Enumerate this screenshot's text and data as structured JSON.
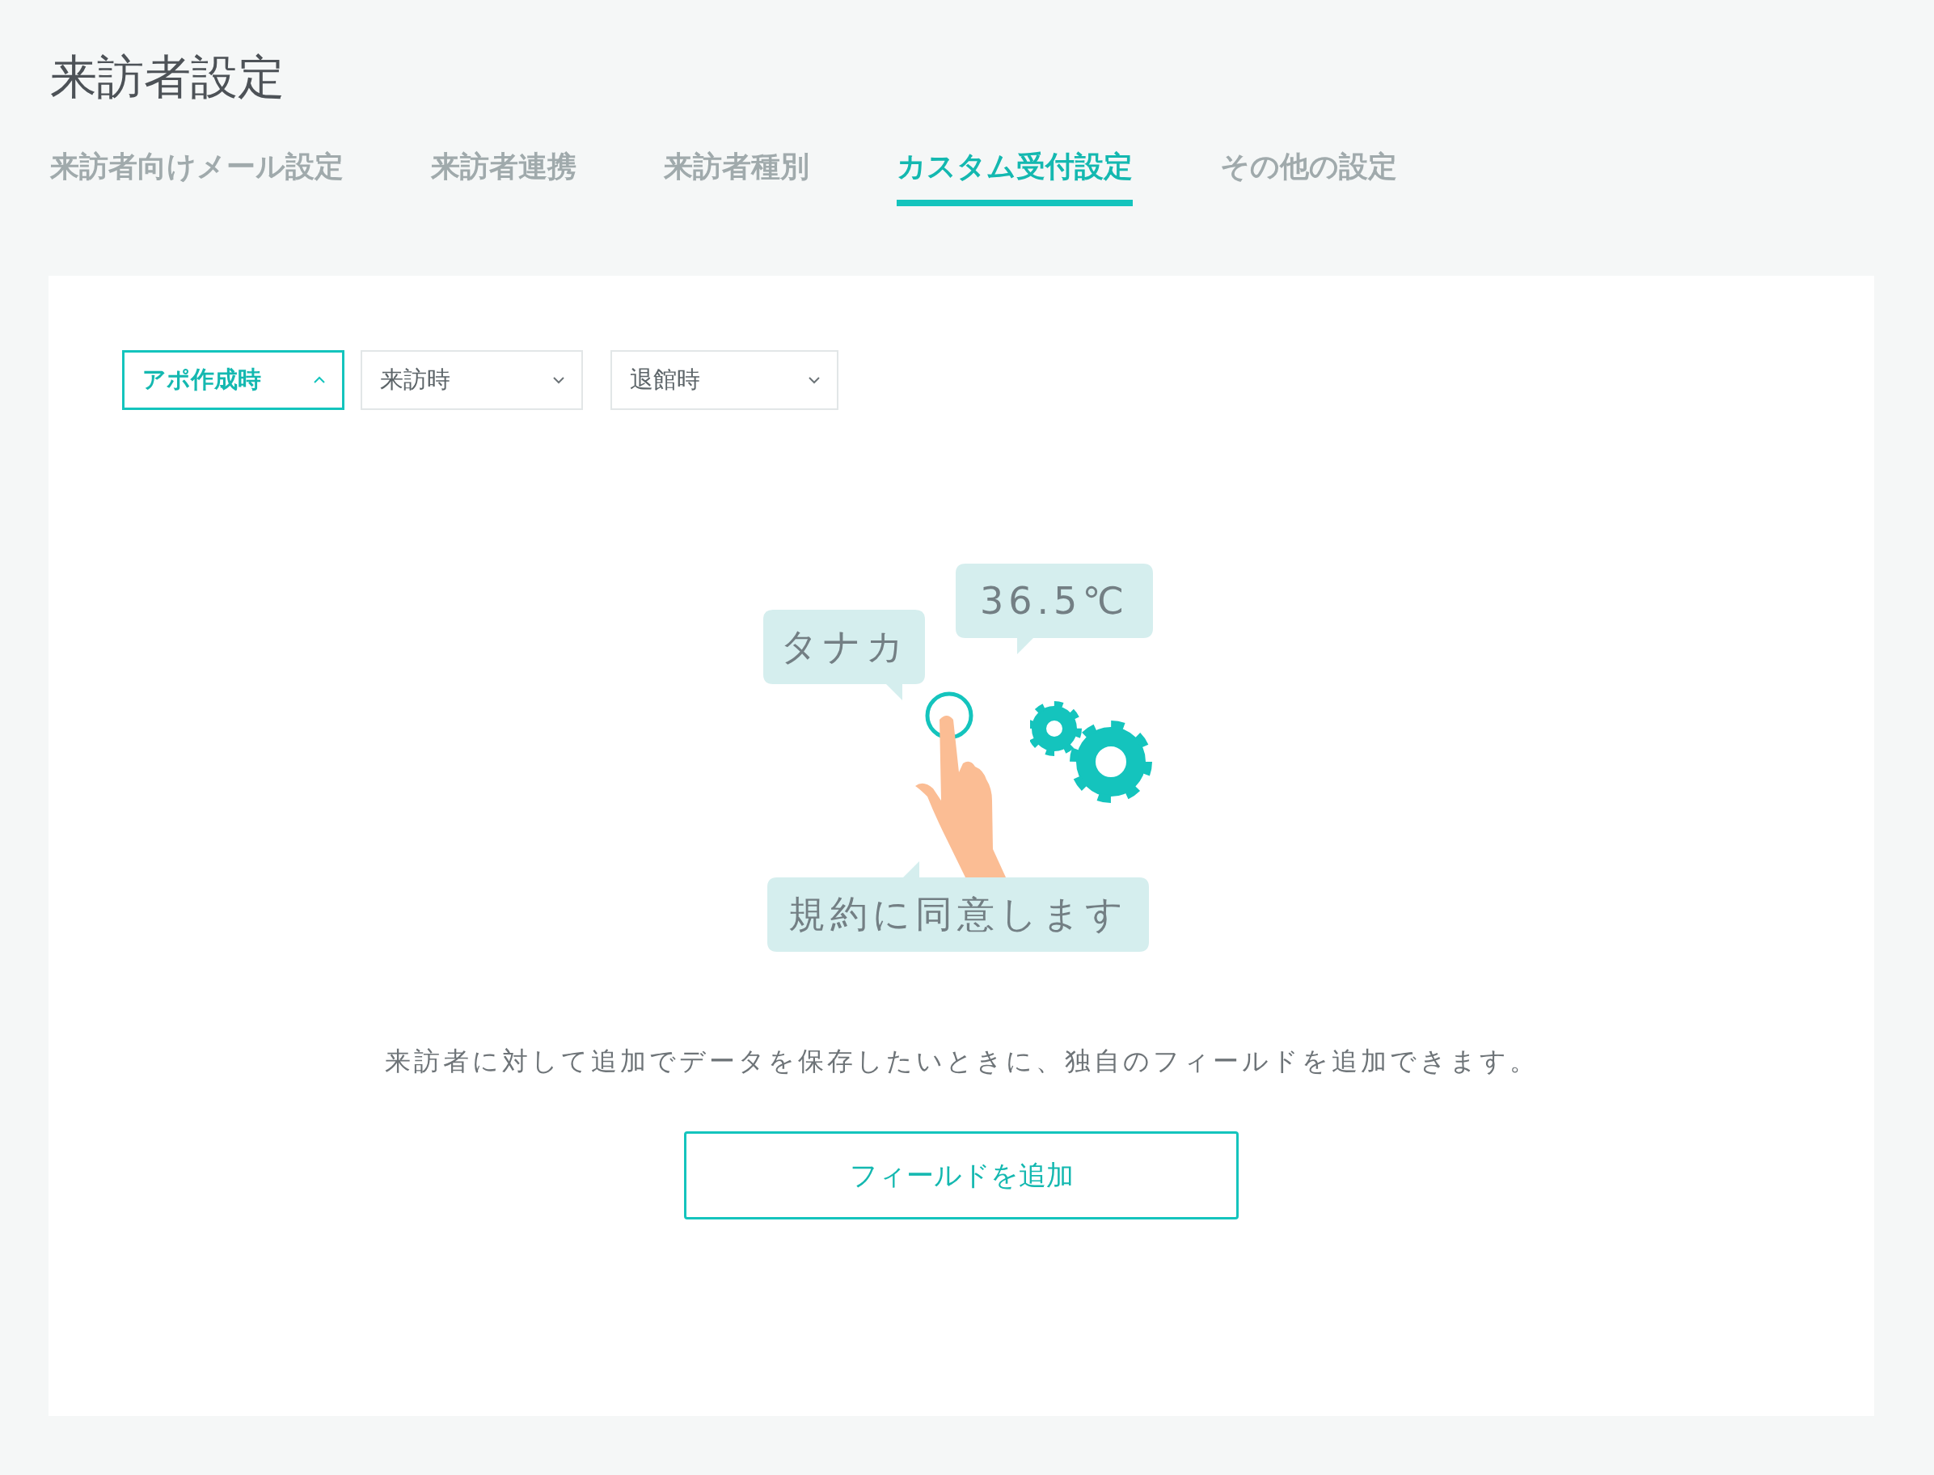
{
  "page": {
    "title": "来訪者設定"
  },
  "tabs": [
    {
      "label": "来訪者向けメール設定",
      "selected": false
    },
    {
      "label": "来訪者連携",
      "selected": false
    },
    {
      "label": "来訪者種別",
      "selected": false
    },
    {
      "label": "カスタム受付設定",
      "selected": true
    },
    {
      "label": "その他の設定",
      "selected": false
    }
  ],
  "dropdowns": [
    {
      "label": "アポ作成時",
      "selected": true
    },
    {
      "label": "来訪時",
      "selected": false
    },
    {
      "label": "退館時",
      "selected": false
    }
  ],
  "illustration": {
    "bubbles": [
      "タナカ",
      "36.5℃",
      "規約に同意します"
    ]
  },
  "description": "来訪者に対して追加でデータを保存したいときに、独自のフィールドを追加できます。",
  "add_button": {
    "label": "フィールドを追加"
  }
}
